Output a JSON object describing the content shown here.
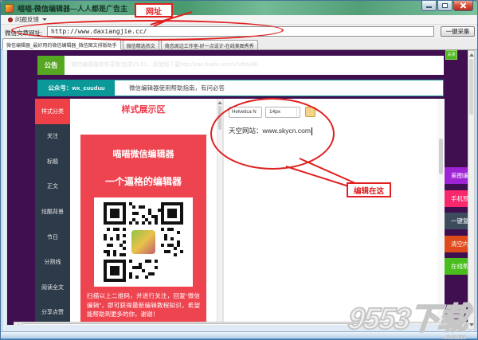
{
  "window": {
    "title": "喵喵-微信编辑器---人人都是广告主"
  },
  "menu": {
    "feedback_label": "问题反馈"
  },
  "url_bar": {
    "label": "微信文章网址:",
    "value": "http://www.daxiangjie.cc/",
    "collect_button": "一键采集"
  },
  "tabs": [
    {
      "label": "微信编辑器_最好用的微信编辑器_微信图文排版助手",
      "active": true
    },
    {
      "label": "微信精选热文",
      "active": false
    },
    {
      "label": "倚恋周边工作室-好一点设计-在线美图秀秀",
      "active": false
    }
  ],
  "annotations": {
    "url_callout": "网址",
    "edit_callout": "编辑在这"
  },
  "announcement": {
    "label": "公告",
    "text": "微信编辑器软件更新完成V1.01，请使用下载http://pan.baidu.com/s/1dfdyi8b",
    "close_label": "关闭"
  },
  "official_account": {
    "label": "公众号：wx_cuuduu",
    "description": "微信编辑器使用帮助指南，有问必答"
  },
  "sidebar": {
    "items": [
      {
        "label": "样式分类",
        "active": true
      },
      {
        "label": "关注",
        "active": false
      },
      {
        "label": "标题",
        "active": false
      },
      {
        "label": "正文",
        "active": false
      },
      {
        "label": "炫酷背景",
        "active": false
      },
      {
        "label": "节日",
        "active": false
      },
      {
        "label": "分割线",
        "active": false
      },
      {
        "label": "阅读全文",
        "active": false
      },
      {
        "label": "分享点赞",
        "active": false
      }
    ]
  },
  "preview": {
    "heading": "样式展示区",
    "card_title": "喵喵微信编辑器",
    "card_subtitle": "一个逼格的编辑器",
    "card_caption": "扫描以上二维码，并进行关注，回复“微信编辑”，即可获得最新编辑教程知识，希望能帮助到更多的你，谢谢！"
  },
  "editor": {
    "font_name": "Helvetica N",
    "font_size": "14px",
    "content": "天空网站：www.skycn.com"
  },
  "action_buttons": [
    {
      "label": "美图编辑",
      "color": "#9d23d4"
    },
    {
      "label": "手机预览",
      "color": "#f9276b"
    },
    {
      "label": "一键复制",
      "color": "#3c4c5c"
    },
    {
      "label": "清空内容",
      "color": "#de4a1b"
    },
    {
      "label": "在线帮助",
      "color": "#49bd1d"
    }
  ],
  "watermark": {
    "text": "9553下载",
    "suffix": ".com"
  },
  "colors": {
    "annotation_red": "#e02020",
    "purple_background": "#400f50",
    "teal": "#0a9898",
    "announce_green": "#56a822",
    "card_red": "#ee4450",
    "sidebar_background": "#2c3a49",
    "sidebar_active": "#ee4147",
    "swatch_tan": "#f4d488"
  }
}
